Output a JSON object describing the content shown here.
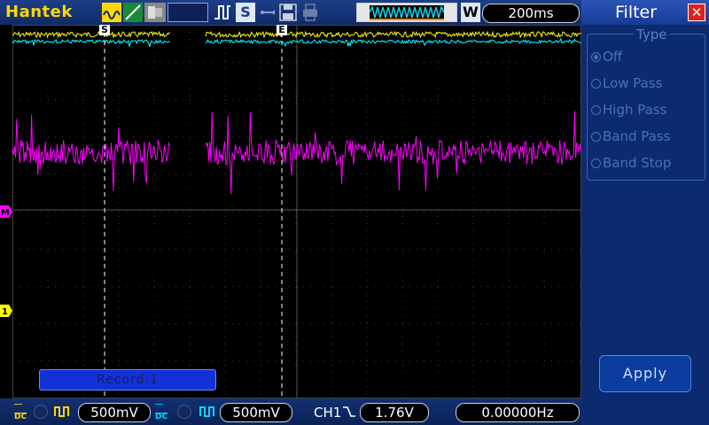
{
  "header": {
    "brand": "Hantek",
    "timebase": "200ms",
    "window_label": "W"
  },
  "waveform": {
    "cursor_start_label": "S",
    "cursor_end_label": "E",
    "math_marker": "M",
    "ch1_marker": "1",
    "record_label": "Record:1"
  },
  "footer": {
    "ch1_coupling": "DC",
    "ch1_scale": "500mV",
    "ch2_coupling": "DC",
    "ch2_scale": "500mV",
    "trigger_source": "CH1",
    "trigger_level": "1.76V",
    "frequency": "0.00000Hz"
  },
  "panel": {
    "title": "Filter",
    "group_label": "Type",
    "options": [
      "Off",
      "Low Pass",
      "High Pass",
      "Band Pass",
      "Band Stop"
    ],
    "selected": "Off",
    "apply_label": "Apply"
  },
  "colors": {
    "ch1": "#ffff00",
    "ch2": "#00ffff",
    "math": "#ff00ff",
    "panel_bg": "#0b2a70"
  }
}
